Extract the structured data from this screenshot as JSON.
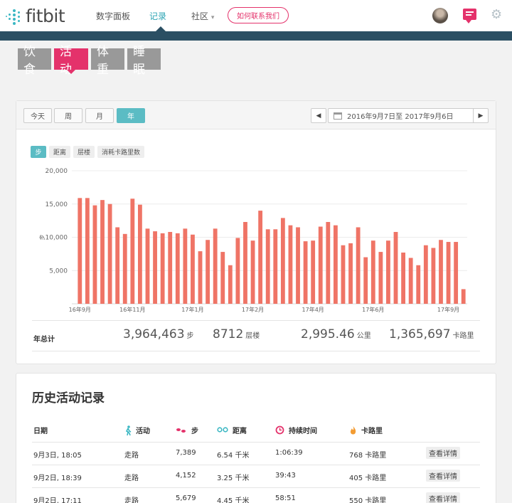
{
  "header": {
    "logo_text": "fitbit",
    "nav": [
      {
        "label": "数字面板"
      },
      {
        "label": "记录"
      },
      {
        "label": "社区"
      }
    ],
    "community_caret": "▾",
    "contact_label": "如何联系我们",
    "gear_glyph": "⚙"
  },
  "subtabs": [
    {
      "label": "饮食"
    },
    {
      "label": "活动"
    },
    {
      "label": "体重"
    },
    {
      "label": "睡眠"
    }
  ],
  "toolbar": {
    "periods": [
      {
        "label": "今天"
      },
      {
        "label": "周"
      },
      {
        "label": "月"
      },
      {
        "label": "年"
      }
    ],
    "prev_glyph": "◀",
    "next_glyph": "▶",
    "date_range": "2016年9月7日至 2017年9月6日"
  },
  "metrics": [
    {
      "label": "步"
    },
    {
      "label": "距离"
    },
    {
      "label": "层楼"
    },
    {
      "label": "消耗卡路里数"
    }
  ],
  "chart_data": {
    "type": "bar",
    "ylabel": "步",
    "ylim": [
      0,
      20000
    ],
    "yticks": [
      "20,000",
      "15,000",
      "10,000",
      "5,000"
    ],
    "ytick_values": [
      20000,
      15000,
      10000,
      5000
    ],
    "xtick_labels": [
      "16年9月",
      "16年11月",
      "17年1月",
      "17年2月",
      "17年4月",
      "17年6月",
      "17年9月"
    ],
    "xtick_index": [
      0,
      7,
      15,
      23,
      31,
      39,
      49
    ],
    "bar_color": "#ef7466",
    "values": [
      15900,
      15900,
      14800,
      15600,
      15000,
      11500,
      10500,
      15800,
      14900,
      11300,
      10900,
      10600,
      10800,
      10600,
      11300,
      10400,
      7900,
      9600,
      11300,
      7800,
      5800,
      9900,
      12300,
      9500,
      14000,
      11200,
      11200,
      12900,
      11800,
      11500,
      9400,
      9500,
      11600,
      12300,
      11800,
      8800,
      9100,
      11500,
      7000,
      9500,
      7800,
      9500,
      10800,
      7700,
      6900,
      5800,
      8800,
      8400,
      9600,
      9300,
      9300,
      2200
    ]
  },
  "totals": {
    "label": "年总计",
    "steps": "3,964,463",
    "steps_unit": "步",
    "floors": "8712",
    "floors_unit": "层楼",
    "distance": "2,995.46",
    "distance_unit": "公里",
    "calories": "1,365,697",
    "calories_unit": "卡路里"
  },
  "history": {
    "title": "历史活动记录",
    "columns": {
      "date": "日期",
      "activity": "活动",
      "steps": "步",
      "distance": "距离",
      "duration": "持续时间",
      "calories": "卡路里"
    },
    "icon_colors": {
      "activity": "#3bb7c3",
      "steps": "#e4326b",
      "distance": "#3bb7c3",
      "duration": "#e4326b",
      "calories": "#f39c33"
    },
    "rows": [
      {
        "date": "9月3日, 18:05",
        "activity": "走路",
        "steps": "7,389",
        "distance": "6.54 千米",
        "duration": "1:06:39",
        "calories": "768 卡路里",
        "detail": "查看详情"
      },
      {
        "date": "9月2日, 18:39",
        "activity": "走路",
        "steps": "4,152",
        "distance": "3.25 千米",
        "duration": "39:43",
        "calories": "405 卡路里",
        "detail": "查看详情"
      },
      {
        "date": "9月2日, 17:11",
        "activity": "走路",
        "steps": "5,679",
        "distance": "4.45 千米",
        "duration": "58:51",
        "calories": "550 卡路里",
        "detail": "查看详情"
      }
    ]
  }
}
